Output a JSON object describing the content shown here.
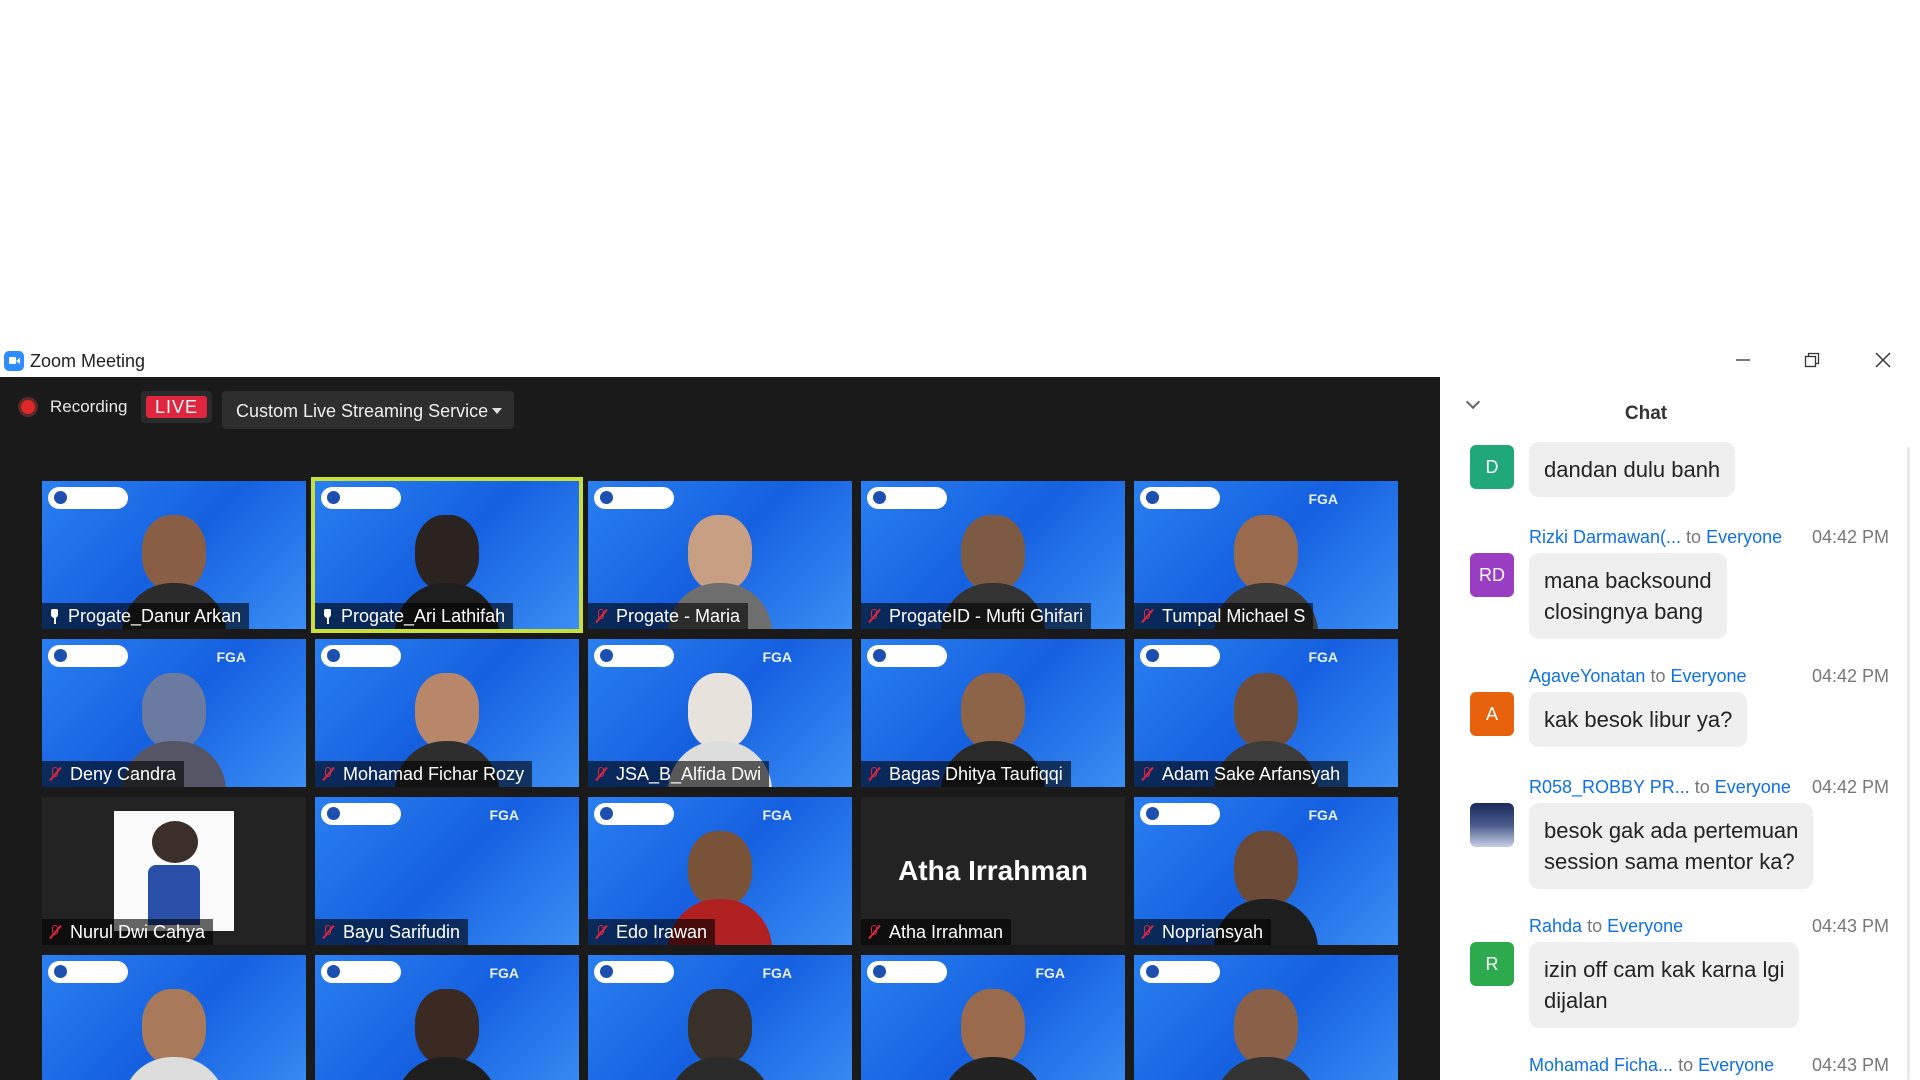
{
  "window": {
    "title": "Zoom Meeting"
  },
  "toolbar": {
    "recording_label": "Recording",
    "live_badge": "LIVE",
    "streaming_service": "Custom Live Streaming Service"
  },
  "tiles": [
    {
      "name": "Progate_Danur Arkan",
      "mic": "pinned"
    },
    {
      "name": "Progate_Ari Lathifah",
      "mic": "pinned",
      "active_speaker": true
    },
    {
      "name": "Progate - Maria",
      "mic": "muted"
    },
    {
      "name": "ProgateID - Mufti Ghifari",
      "mic": "muted"
    },
    {
      "name": "Tumpal Michael S",
      "mic": "muted"
    },
    {
      "name": "Deny Candra",
      "mic": "muted"
    },
    {
      "name": "Mohamad Fichar Rozy",
      "mic": "muted"
    },
    {
      "name": "JSA_B_Alfida Dwi",
      "mic": "muted"
    },
    {
      "name": "Bagas Dhitya Taufiqqi",
      "mic": "muted"
    },
    {
      "name": "Adam Sake Arfansyah",
      "mic": "muted"
    },
    {
      "name": "Nurul Dwi Cahya",
      "mic": "muted",
      "avatar": "profile-picture"
    },
    {
      "name": "Bayu Sarifudin",
      "mic": "muted"
    },
    {
      "name": "Edo Irawan",
      "mic": "muted"
    },
    {
      "name": "Atha Irrahman",
      "mic": "muted",
      "display_name_large": "Atha Irrahman"
    },
    {
      "name": "Nopriansyah",
      "mic": "muted"
    }
  ],
  "chat": {
    "title": "Chat",
    "to_word": "to",
    "messages": [
      {
        "avatar_initials": "D",
        "avatar_color": "#20a87a",
        "text": "dandan dulu banh"
      },
      {
        "sender": "Rizki Darmawan(...",
        "recipient": "Everyone",
        "time": "04:42 PM",
        "avatar_initials": "RD",
        "avatar_color": "#9b3dc2",
        "text_lines": [
          "mana backsound",
          "closingnya bang"
        ]
      },
      {
        "sender": "AgaveYonatan",
        "recipient": "Everyone",
        "time": "04:42 PM",
        "avatar_initials": "A",
        "avatar_color": "#e8610c",
        "text": "kak besok libur ya?"
      },
      {
        "sender": "R058_ROBBY PR...",
        "recipient": "Everyone",
        "time": "04:42 PM",
        "avatar_initials": "",
        "avatar_color": "#3a4a78",
        "text_lines": [
          "besok gak ada pertemuan",
          "session sama mentor ka?"
        ]
      },
      {
        "sender": "Rahda",
        "recipient": "Everyone",
        "time": "04:43 PM",
        "avatar_initials": "R",
        "avatar_color": "#2eaa4e",
        "text_lines": [
          "izin off cam kak karna lgi",
          "dijalan"
        ]
      },
      {
        "sender": "Mohamad Ficha...",
        "recipient": "Everyone",
        "time": "04:43 PM"
      }
    ]
  }
}
